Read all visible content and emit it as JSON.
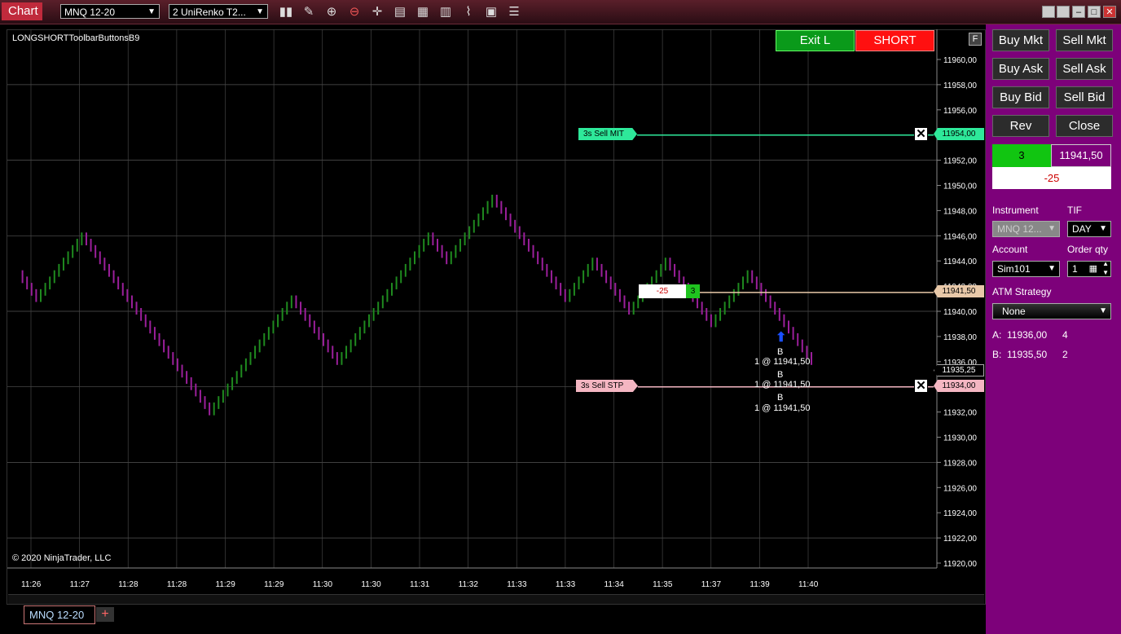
{
  "window": {
    "tab": "Chart",
    "instrument": "MNQ 12-20",
    "bar_type": "2 UniRenko T2..."
  },
  "toolbar": {
    "icons": [
      "bars-icon",
      "pencil-icon",
      "zoom-in-icon",
      "zoom-out-icon",
      "crosshair-icon",
      "data-box-icon",
      "templates-icon",
      "chart-style-icon",
      "indicators-icon",
      "strategies-icon",
      "properties-icon"
    ]
  },
  "chart": {
    "indicator_label": "LONGSHORTToolbarButtonsB9",
    "copyright": "© 2020 NinjaTrader, LLC",
    "exit_button": "Exit L",
    "short_button": "SHORT",
    "f_button": "F",
    "price_ticks": [
      "11960,00",
      "11958,00",
      "11956,00",
      "11954,00",
      "11952,00",
      "11950,00",
      "11948,00",
      "11946,00",
      "11944,00",
      "11942,00",
      "11940,00",
      "11938,00",
      "11936,00",
      "11934,00",
      "11932,00",
      "11930,00",
      "11928,00",
      "11926,00",
      "11924,00",
      "11922,00",
      "11920,00"
    ],
    "time_ticks": [
      "11:26",
      "11:27",
      "11:28",
      "11:28",
      "11:29",
      "11:29",
      "11:30",
      "11:30",
      "11:31",
      "11:32",
      "11:33",
      "11:33",
      "11:34",
      "11:35",
      "11:37",
      "11:39",
      "11:40"
    ],
    "sell_mit": {
      "label": "3s  Sell MIT",
      "price": "11954,00"
    },
    "sell_stp": {
      "label": "3s  Sell STP",
      "price": "11934,00"
    },
    "position": {
      "pnl": "-25",
      "qty": "3",
      "price": "11941,50"
    },
    "last_price": "11935,25",
    "executions": [
      {
        "side": "B",
        "fill": "1 @ 11941,50"
      },
      {
        "side": "B",
        "fill": "1 @ 11941,50"
      },
      {
        "side": "B",
        "fill": "1 @ 11941,50"
      }
    ]
  },
  "side_panel": {
    "buttons": [
      {
        "label": "Buy Mkt"
      },
      {
        "label": "Sell Mkt"
      },
      {
        "label": "Buy Ask"
      },
      {
        "label": "Sell Ask"
      },
      {
        "label": "Buy Bid"
      },
      {
        "label": "Sell Bid"
      },
      {
        "label": "Rev"
      },
      {
        "label": "Close"
      }
    ],
    "position_qty": "3",
    "position_price": "11941,50",
    "position_pnl": "-25",
    "instrument_label": "Instrument",
    "instrument_value": "MNQ 12...",
    "tif_label": "TIF",
    "tif_value": "DAY",
    "account_label": "Account",
    "account_value": "Sim101",
    "order_qty_label": "Order qty",
    "order_qty_value": "1",
    "atm_label": "ATM Strategy",
    "atm_value": "None",
    "ask_label": "A:",
    "ask_price": "11936,00",
    "ask_size": "4",
    "bid_label": "B:",
    "bid_price": "11935,50",
    "bid_size": "2"
  },
  "bottom": {
    "doc_tab": "MNQ 12-20",
    "add_tab": "+"
  },
  "colors": {
    "side_panel": "#7d017a",
    "up_bar": "#1f8a1f",
    "down_bar": "#9b1f9b",
    "exit_green": "#00a000",
    "short_red": "#ff1010",
    "mit_line": "#2ee89a",
    "stp_line": "#f4b6c2",
    "position_line": "#e8c8a8"
  },
  "price_path": [
    11943,
    11941,
    11946,
    11945,
    11940,
    11935,
    11932,
    11938,
    11941,
    11936,
    11942,
    11946,
    11944,
    11949,
    11947,
    11943,
    11941,
    11944,
    11940,
    11942,
    11944,
    11939,
    11943,
    11941,
    11936
  ]
}
